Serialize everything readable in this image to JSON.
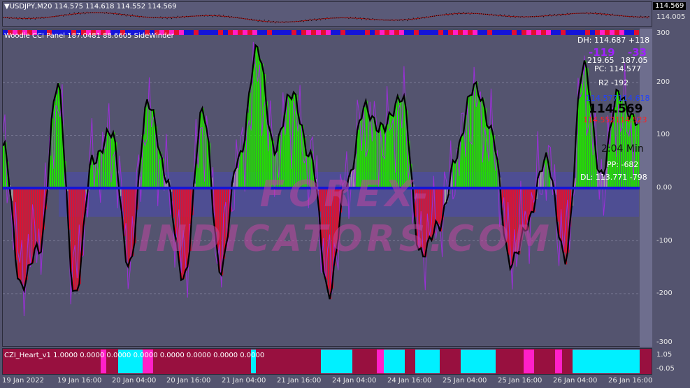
{
  "price_panel": {
    "header": "▼USDJPY,M20 114.575 114.618 114.552 114.569",
    "axis_labels": [
      "114.569",
      "114.005"
    ],
    "current_price": "114.569"
  },
  "cci_panel": {
    "title": "Woodie CCI Panel 187.0481 88.6605 SideWinder",
    "axis_labels": [
      "300",
      "200",
      "100",
      "0.00",
      "-100",
      "-200",
      "-300"
    ],
    "info": {
      "dh": "DH: 114.687 +118",
      "cci_left": "-119",
      "cci_right": "-33",
      "val_left": "219.65",
      "val_right": "187.05",
      "pc": "PC: 114.577",
      "r2": "R2 -192",
      "open_blue": "114.577",
      "high_blue": "114.618",
      "price_big": "114.569",
      "low_red": "114.552",
      "close_red": "114.523",
      "timer": "2:04 Min",
      "pp": "PP: -682",
      "dl": "DL: 113.771 -798"
    },
    "watermark": "FOREX-INDICATORS.COM"
  },
  "heart_panel": {
    "title": "CZI_Heart_v1 1.0000 0.0000 0.0000 0.0000 0.0000 0.0000 0.0000 0.0000",
    "axis_labels": [
      "1.05",
      "-0.05"
    ]
  },
  "time_axis": [
    "19 Jan 2022",
    "19 Jan 16:00",
    "20 Jan 04:00",
    "20 Jan 16:00",
    "21 Jan 04:00",
    "21 Jan 16:00",
    "24 Jan 04:00",
    "24 Jan 16:00",
    "25 Jan 04:00",
    "25 Jan 16:00",
    "26 Jan 04:00",
    "26 Jan 16:00"
  ],
  "colors": {
    "background": "#54546f",
    "axis_bg": "#6e6e8e",
    "up_bar": "#22e000",
    "down_bar": "#e01030",
    "cci_line": "#000000",
    "turbo_line": "#9b30d8",
    "zero_line": "#1515d8",
    "heart_crimson": "#98103f",
    "heart_cyan": "#00f0ff",
    "heart_magenta": "#ff20c8"
  },
  "chart_data": {
    "type": "line",
    "x": [
      "19 Jan 2022",
      "19 Jan 16:00",
      "20 Jan 04:00",
      "20 Jan 16:00",
      "21 Jan 04:00",
      "21 Jan 16:00",
      "24 Jan 04:00",
      "24 Jan 16:00",
      "25 Jan 04:00",
      "25 Jan 16:00",
      "26 Jan 04:00",
      "26 Jan 16:00"
    ],
    "series": [
      {
        "name": "CCI",
        "values": [
          80,
          -180,
          -120,
          190,
          -200,
          60,
          100,
          -150,
          170,
          20,
          -180,
          150,
          -150,
          50,
          260,
          80,
          180,
          50,
          -200,
          20,
          150,
          110,
          180,
          -120,
          -80,
          60,
          200,
          100,
          -150,
          -60,
          60,
          -140,
          230,
          30,
          180,
          120
        ]
      }
    ],
    "ylim": [
      -300,
      300
    ],
    "grid": true
  }
}
